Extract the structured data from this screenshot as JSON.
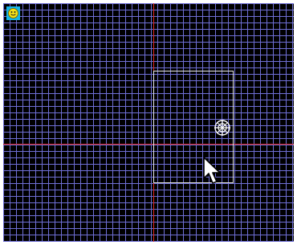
{
  "scene": {
    "background_color": "#000000",
    "grid_color": "#6f6fd6",
    "axis_color": "#e0261f",
    "frame_color": "#e8e8e8"
  },
  "icons": {
    "badge": "smiley-icon",
    "crosshair": "crosshair-icon",
    "cursor": "mouse-pointer-icon"
  }
}
